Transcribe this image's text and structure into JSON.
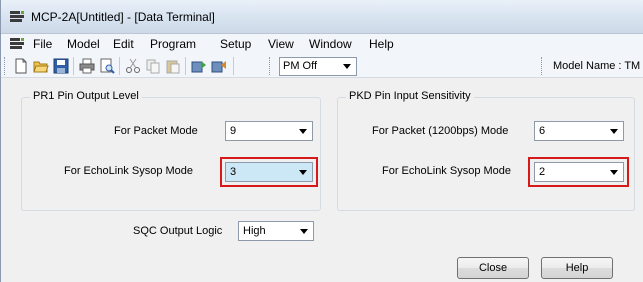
{
  "window": {
    "title": "MCP-2A[Untitled] - [Data Terminal]"
  },
  "menu": {
    "items": [
      "File",
      "Model",
      "Edit",
      "Program",
      "Setup",
      "View",
      "Window",
      "Help"
    ]
  },
  "toolbar": {
    "buttons": [
      "new-icon",
      "open-icon",
      "save-icon",
      "print-icon",
      "print-preview-icon",
      "cut-icon",
      "copy-icon",
      "paste-icon",
      "read-radio-icon",
      "write-radio-icon"
    ],
    "pm_select": "PM Off",
    "model_label": "Model Name : TM"
  },
  "pr1": {
    "title": "PR1 Pin Output Level",
    "packet_label": "For Packet Mode",
    "packet_value": "9",
    "echolink_label": "For EchoLink Sysop Mode",
    "echolink_value": "3"
  },
  "pkd": {
    "title": "PKD Pin Input Sensitivity",
    "packet_label": "For Packet (1200bps) Mode",
    "packet_value": "6",
    "echolink_label": "For EchoLink Sysop Mode",
    "echolink_value": "2"
  },
  "sqc": {
    "label": "SQC Output Logic",
    "value": "High"
  },
  "buttons": {
    "close": "Close",
    "help": "Help"
  },
  "colors": {
    "highlight_box": "#d61a1a",
    "selected_field": "#cce8f6"
  }
}
